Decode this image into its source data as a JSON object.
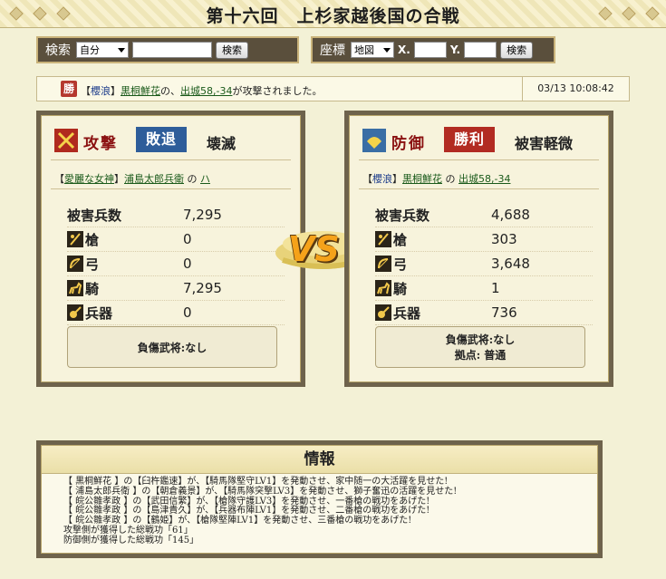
{
  "title": "第十六回　上杉家越後国の合戦",
  "search": {
    "label": "検索",
    "select_value": "自分",
    "button": "検索"
  },
  "coord": {
    "label": "座標",
    "select_value": "地図",
    "x_label": "X.",
    "y_label": "Y.",
    "button": "検索"
  },
  "notice": {
    "icon": "勝",
    "pre": "【",
    "alliance": "櫻浪",
    "mid1": "】",
    "player": "黒桐鮮花",
    "mid2": "の、",
    "place": "出城58,-34",
    "post": "が攻撃されました。",
    "time": "03/13 10:08:42"
  },
  "attacker": {
    "side_label": "攻撃",
    "result": "敗退",
    "result_color": "#2e5d9a",
    "damage": "壊滅",
    "alliance": "愛麗な女神",
    "player": "浦島太郎兵衛",
    "particle": "の",
    "target": "ハ",
    "stats_header": "被害兵数",
    "total": "7,295",
    "rows": [
      {
        "name": "槍",
        "value": "0"
      },
      {
        "name": "弓",
        "value": "0"
      },
      {
        "name": "騎",
        "value": "7,295"
      },
      {
        "name": "兵器",
        "value": "0"
      }
    ],
    "wounded": "負傷武将:なし"
  },
  "defender": {
    "side_label": "防御",
    "result": "勝利",
    "result_color": "#b22b22",
    "damage": "被害軽微",
    "alliance": "櫻浪",
    "player": "黒桐鮮花",
    "particle": "の",
    "target": "出城58,-34",
    "stats_header": "被害兵数",
    "total": "4,688",
    "rows": [
      {
        "name": "槍",
        "value": "303"
      },
      {
        "name": "弓",
        "value": "3,648"
      },
      {
        "name": "騎",
        "value": "1"
      },
      {
        "name": "兵器",
        "value": "736"
      }
    ],
    "wounded": "負傷武将:なし",
    "base": "拠点: 普通"
  },
  "vs_text": "VS",
  "info": {
    "heading": "情報",
    "lines": [
      "【 黒桐鮮花 】の【臼杵鑑速】が、【騎馬隊堅守LV1】を発動させ、家中随一の大活躍を見せた!",
      "【 浦島太郎兵衛 】の【朝倉義景】が、【騎馬隊突撃LV3】を発動させ、獅子奮迅の活躍を見せた!",
      "【 皖公雛孝政 】の【武田信繁】が、【槍隊守護LV3】を発動させ、一番槍の戦功をあげた!",
      "【 皖公雛孝政 】の【島津貴久】が、【兵器布陣LV1】を発動させ、二番槍の戦功をあげた!",
      "【 皖公雛孝政 】の【鶴姫】が、【槍隊堅陣LV1】を発動させ、三番槍の戦功をあげた!",
      "攻撃側が獲得した総戦功「61」",
      "防御側が獲得した総戦功「145」"
    ]
  },
  "colors": {
    "panel": "#5a4f3c",
    "card_frame": "#6e634c",
    "background": "#f3f1d6",
    "link": "#1a5a1a"
  }
}
